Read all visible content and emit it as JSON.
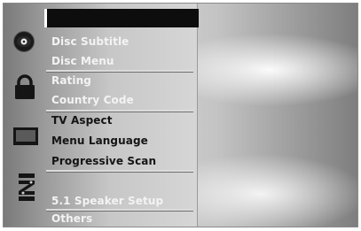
{
  "menu": {
    "sections": [
      {
        "icon": "disc-icon",
        "items": [
          "Disc Subtitle",
          "Disc Menu"
        ]
      },
      {
        "icon": "lock-icon",
        "items": [
          "Rating",
          "Country Code"
        ]
      },
      {
        "icon": "tv-icon",
        "items": [
          "TV Aspect",
          "Menu Language",
          "Progressive Scan"
        ]
      },
      {
        "icon": "speaker-icon",
        "items": [
          "5.1 Speaker Setup"
        ]
      },
      {
        "icon": "others-icon",
        "items": [
          "Others"
        ]
      }
    ]
  },
  "colors": {
    "header_bar": "#0d0d0d",
    "active_text": "#141414",
    "inactive_text": "#efefef"
  }
}
